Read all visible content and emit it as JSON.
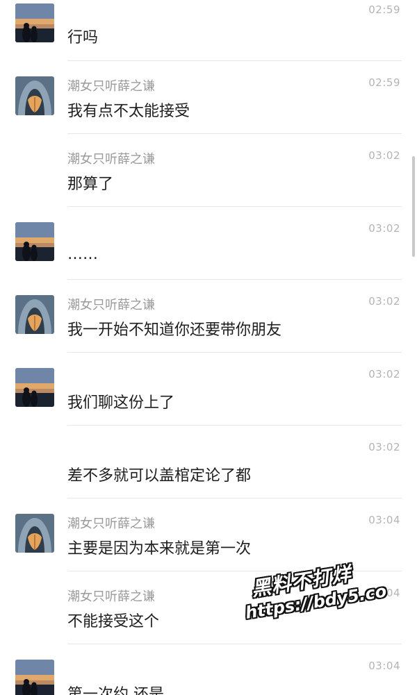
{
  "messages": [
    {
      "avatar": "sunset-couple",
      "name": "",
      "time": "02:59",
      "text": "行吗"
    },
    {
      "avatar": "hooded-girl",
      "name": "潮女只听薛之谦",
      "time": "02:59",
      "text": "我有点不太能接受"
    },
    {
      "avatar": "",
      "name": "潮女只听薛之谦",
      "time": "03:02",
      "text": "那算了"
    },
    {
      "avatar": "sunset-couple",
      "name": "",
      "time": "03:02",
      "text": "……"
    },
    {
      "avatar": "hooded-girl",
      "name": "潮女只听薛之谦",
      "time": "03:02",
      "text": "我一开始不知道你还要带你朋友"
    },
    {
      "avatar": "sunset-couple",
      "name": "",
      "time": "03:02",
      "text": "我们聊这份上了"
    },
    {
      "avatar": "",
      "name": "",
      "time": "03:02",
      "text": "差不多就可以盖棺定论了都"
    },
    {
      "avatar": "hooded-girl",
      "name": "潮女只听薛之谦",
      "time": "03:04",
      "text": "主要是因为本来就是第一次"
    },
    {
      "avatar": "",
      "name": "潮女只听薛之谦",
      "time": "03:04",
      "text": "不能接受这个"
    },
    {
      "avatar": "sunset-couple",
      "name": "",
      "time": "03:04",
      "text": "第一次约 还是"
    }
  ],
  "watermark": {
    "line1": "黑料不打烊",
    "line2": "https://bdy5.co"
  }
}
